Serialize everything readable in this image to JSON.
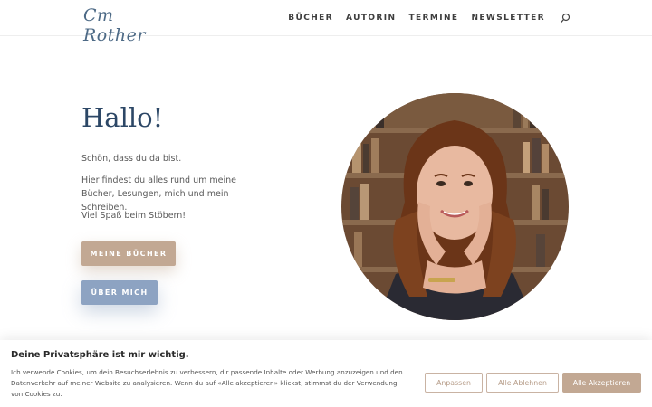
{
  "header": {
    "logo_text": "Cm Rother",
    "nav": [
      {
        "label": "BÜCHER"
      },
      {
        "label": "AUTORIN"
      },
      {
        "label": "TERMINE"
      },
      {
        "label": "NEWSLETTER"
      }
    ],
    "search_icon": "search-icon"
  },
  "hero": {
    "title": "Hallo!",
    "para1": "Schön, dass du da bist.",
    "para2": "Hier findest du alles rund um meine Bücher, Lesungen, mich und mein Schreiben.",
    "para3": "Viel Spaß beim Stöbern!",
    "btn_books": "MEINE BÜCHER",
    "btn_about": "ÜBER MICH"
  },
  "cookie": {
    "title": "Deine Privatsphäre ist mir wichtig.",
    "text": "Ich verwende Cookies, um dein Besuchserlebnis zu verbessern, dir passende Inhalte oder Werbung anzuzeigen und den Datenverkehr auf meiner Website zu analysieren. Wenn du auf «Alle akzeptieren» klickst, stimmst du der Verwendung von Cookies zu.",
    "btn_adjust": "Anpassen",
    "btn_reject": "Alle Ablehnen",
    "btn_accept": "Alle Akzeptieren"
  },
  "colors": {
    "title_blue": "#2c4766",
    "button_tan": "#c2a893",
    "button_blue": "#8da3c2"
  }
}
